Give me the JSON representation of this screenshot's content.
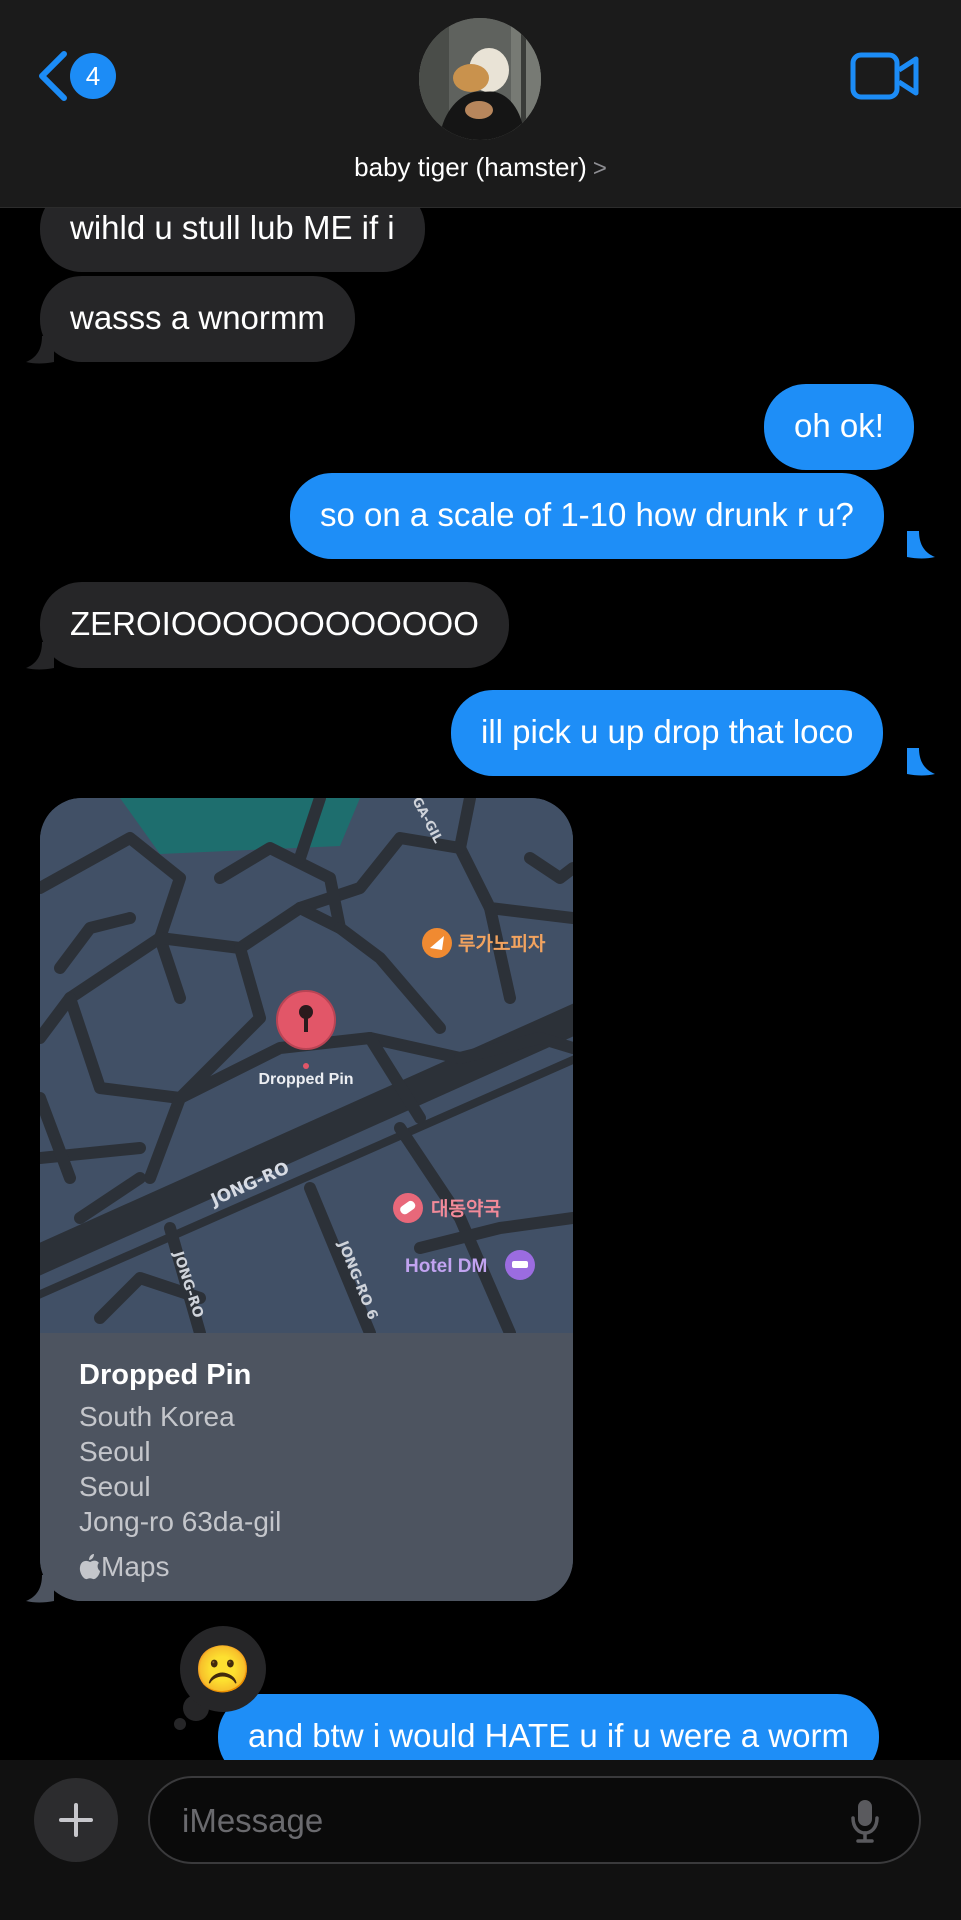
{
  "header": {
    "back_badge": "4",
    "contact_name": "baby tiger (hamster)",
    "contact_chevron": ">"
  },
  "messages": [
    {
      "from": "them",
      "text": "wihld u stull lub ME if i"
    },
    {
      "from": "them",
      "text": "wasss a  wnormm"
    },
    {
      "from": "me",
      "text": "oh ok!"
    },
    {
      "from": "me",
      "text": "so on a scale of 1-10 how drunk r u?"
    },
    {
      "from": "them",
      "text": "ZEROIOOOOOOOOOOOO"
    },
    {
      "from": "me",
      "text": "ill pick u up drop that loco"
    },
    {
      "from": "me",
      "text": "and btw i would HATE u if u were a worm"
    }
  ],
  "map_card": {
    "pin_label": "Dropped Pin",
    "streets": [
      "JONG-RO",
      "JONG-RO",
      "JONG-RO 6",
      "GA-GIL"
    ],
    "places": [
      "루가노피자",
      "대동약국",
      "Hotel DM"
    ],
    "title": "Dropped Pin",
    "lines": [
      "South Korea",
      "Seoul",
      "Seoul",
      "Jong-ro 63da-gil"
    ],
    "brand": "Maps"
  },
  "reaction": {
    "emoji": "☹️"
  },
  "composer": {
    "placeholder": "iMessage"
  },
  "colors": {
    "outgoing": "#1e8ef7",
    "incoming": "#262628",
    "accent": "#1c8cf6"
  }
}
